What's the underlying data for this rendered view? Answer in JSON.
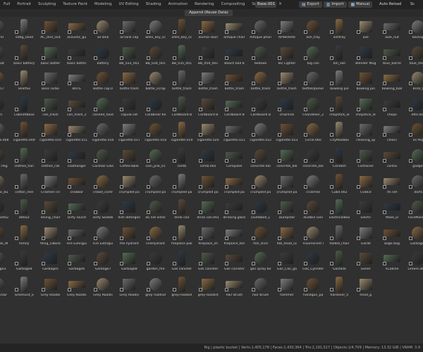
{
  "tabs": [
    "Full",
    "Portrait",
    "Sculpting",
    "Texture Paint",
    "Modeling",
    "UV Editing",
    "Shading",
    "Animation",
    "Rendering",
    "Compositing",
    "Scripting"
  ],
  "active_tab_index": null,
  "scene_name": "Base.001",
  "top_buttons": [
    {
      "label": "Export",
      "icon": "export-icon"
    },
    {
      "label": "Import",
      "icon": "import-icon"
    },
    {
      "label": "Manual",
      "icon": "book-icon"
    }
  ],
  "auto_reload": "Auto Reload",
  "scale_label": "Sc",
  "append_button": "Append (Reuse Data)",
  "accent_color": "#4a4a4a",
  "assets": [
    "_Barrel",
    "10Kg_Used",
    "AC_Unit_Out",
    "acoustic_gu",
    "airTank",
    "airTank cap",
    "allen_key_sc",
    "allen_key_sc",
    "animal skull",
    "antique chair",
    "Antique phon",
    "APilBsRifle",
    "ash_tray",
    "ashtray",
    "axe",
    "axle_nut",
    "BackSp",
    "ball_bat",
    "basic battery",
    "basic batter",
    "basic batter",
    "battery",
    "BB_033_001",
    "BB_034_001",
    "BB_035_001",
    "BB_059_001",
    "Beach ball b",
    "bellows",
    "Bic Lighter",
    "big can",
    "bin_sen",
    "Blender Mug",
    "blue_barrel",
    "blue_sheet",
    "BodyCr",
    "ShelfSa",
    "Boss Turbo",
    "BOTE",
    "Bottle cap.0",
    "bottle trash",
    "bottle_scrap",
    "bottle_trash",
    "bottle_trash",
    "bottle_trash",
    "bottle_trash",
    "bottle_trash",
    "bottleOpener",
    "bowling pin",
    "bowling pin",
    "bowling_ball",
    "brick_t",
    "utton",
    "CabinetBase",
    "can_trash",
    "can_trash_2",
    "canned_food",
    "capula set",
    "Carabiner Ke",
    "Cardboard B",
    "Cardboard B",
    "Cardboard B",
    "Cardboard B",
    "chainlink",
    "Chandelier_2",
    "chopstick_le",
    "chopstick_le",
    "chops",
    "ette.007",
    "cigarette.008",
    "cigarette.009",
    "cigarette.010",
    "cigarette.011",
    "cigarette.016",
    "cigarette.017",
    "cigarette.018",
    "cigarette.019",
    "cigarette.020",
    "cigarette.021",
    "cigarette.022",
    "cigarette.023",
    "Circle.060",
    "CityMailBox",
    "cleaning_sp",
    "cleani",
    "es Peg",
    "Clothes Peg",
    "clothes_han",
    "clothes_rail",
    "coathanger",
    "Cocktail Glas",
    "CoffeeTable",
    "coin_pile_01",
    "comb",
    "comb.002",
    "Computer",
    "concrete blo",
    "concrete_blo",
    "concrete_blo",
    "Condom",
    "Container",
    "contai",
    "gadget",
    "cosmetic_bu",
    "cotton_reel",
    "Crashed Tin",
    "crowbar",
    "crowd_contr",
    "crumpled pa",
    "crumpled pa",
    "crumpled pa",
    "crumpled pa",
    "crumpled pa",
    "crumpled pa",
    "crumpled pa",
    "crutches",
    "Cube.002",
    "CUBE0",
    "rts set",
    "darts",
    "Deodorant02",
    "detour",
    "dining_chair",
    "Dirty round",
    "Dirty Skateb",
    "dish detergen",
    "do not enter",
    "drink can",
    "drink can.001",
    "drinking glass",
    "Dumbbell_L",
    "Dumpster",
    "dustbin Gen",
    "ElectricalBox",
    "Electri",
    "Mask_D",
    "FaceMask_M",
    "FaceMask_M",
    "family",
    "filing_cabine",
    "Fire Extingui",
    "Fire Extingui",
    "fire hydrant",
    "FireHydrant",
    "fireplace pok",
    "fireplace_sh",
    "fireplace_ton",
    "fish_slice",
    "flat_head_sc",
    "Fluorescent l",
    "folded_chair",
    "Garde",
    "bage bag",
    "Garbage2",
    "Garbage3",
    "Garbage4",
    "Garbage5",
    "Garbage6",
    "Garbage7",
    "Garbage8",
    "garden_fire",
    "Gas canister",
    "Gas canister",
    "Gas canister",
    "gas spray bo",
    "Gas_Can_ga",
    "Gas_Cylinder",
    "Gastank",
    "Gener",
    "nCabine",
    "GreenCabine",
    "GreenChair",
    "GreenList_S",
    "Grey Roadsi",
    "Grey Roadsi",
    "Grey Roadsi",
    "Grey Roadsi",
    "grey roadsid",
    "grey-roadsid",
    "grey-roadsid",
    "hair Brush",
    "hair brush",
    "hammer",
    "handgun_pa",
    "hardover_n",
    "head_g"
  ],
  "status_text": "Rig | plastic bucket | Verts:1,405,178 | Faces:1,430,364 | Tris:2,191,517 | Objects:1/4,709 | Memory: 13.32 GiB | VRAM: 3.9"
}
